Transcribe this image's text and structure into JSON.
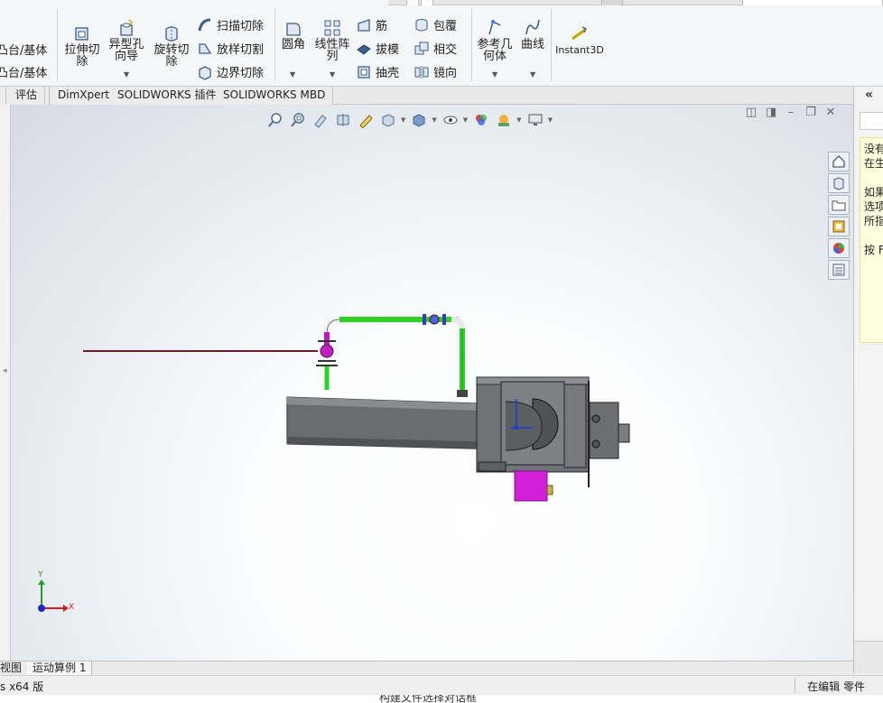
{
  "ribbon": {
    "boss_base_1": "凸台/基体",
    "boss_base_2": "凸台/基体",
    "extruded_cut": "拉伸切\n除",
    "hole_wizard": "异型孔\n向导",
    "revolved_cut": "旋转切\n除",
    "swept_cut": "扫描切除",
    "lofted_cut": "放样切割",
    "boundary_cut": "边界切除",
    "fillet": "圆角",
    "linear_pattern": "线性阵\n列",
    "rib": "筋",
    "draft": "拔模",
    "shell": "抽壳",
    "wrap": "包覆",
    "intersect": "相交",
    "mirror": "镜向",
    "reference_geometry": "参考几\n何体",
    "curves": "曲线",
    "instant3d": "Instant3D"
  },
  "command_tabs": [
    "评估",
    "DimXpert",
    "SOLIDWORKS 插件",
    "SOLIDWORKS MBD"
  ],
  "triad": {
    "y_label": "Y",
    "x_label": "X"
  },
  "task_pane": {
    "collapse_label": "«",
    "note_lines": [
      "没有",
      "在生",
      "",
      "如果",
      "选项",
      "所指",
      "",
      "按 F"
    ]
  },
  "bottom_tabs": [
    "视图",
    "运动算例 1"
  ],
  "status": {
    "left": "s x64 版",
    "mode": "在编辑",
    "doc_type": "零件"
  },
  "bottom_hint": "构建文件选择对话框",
  "colors": {
    "pipe_green": "#2ed12a",
    "valve_magenta": "#c020c0",
    "body_gray": "#6a6c70",
    "motor_magenta": "#d21fd8",
    "note_bg": "#ffffe0"
  }
}
